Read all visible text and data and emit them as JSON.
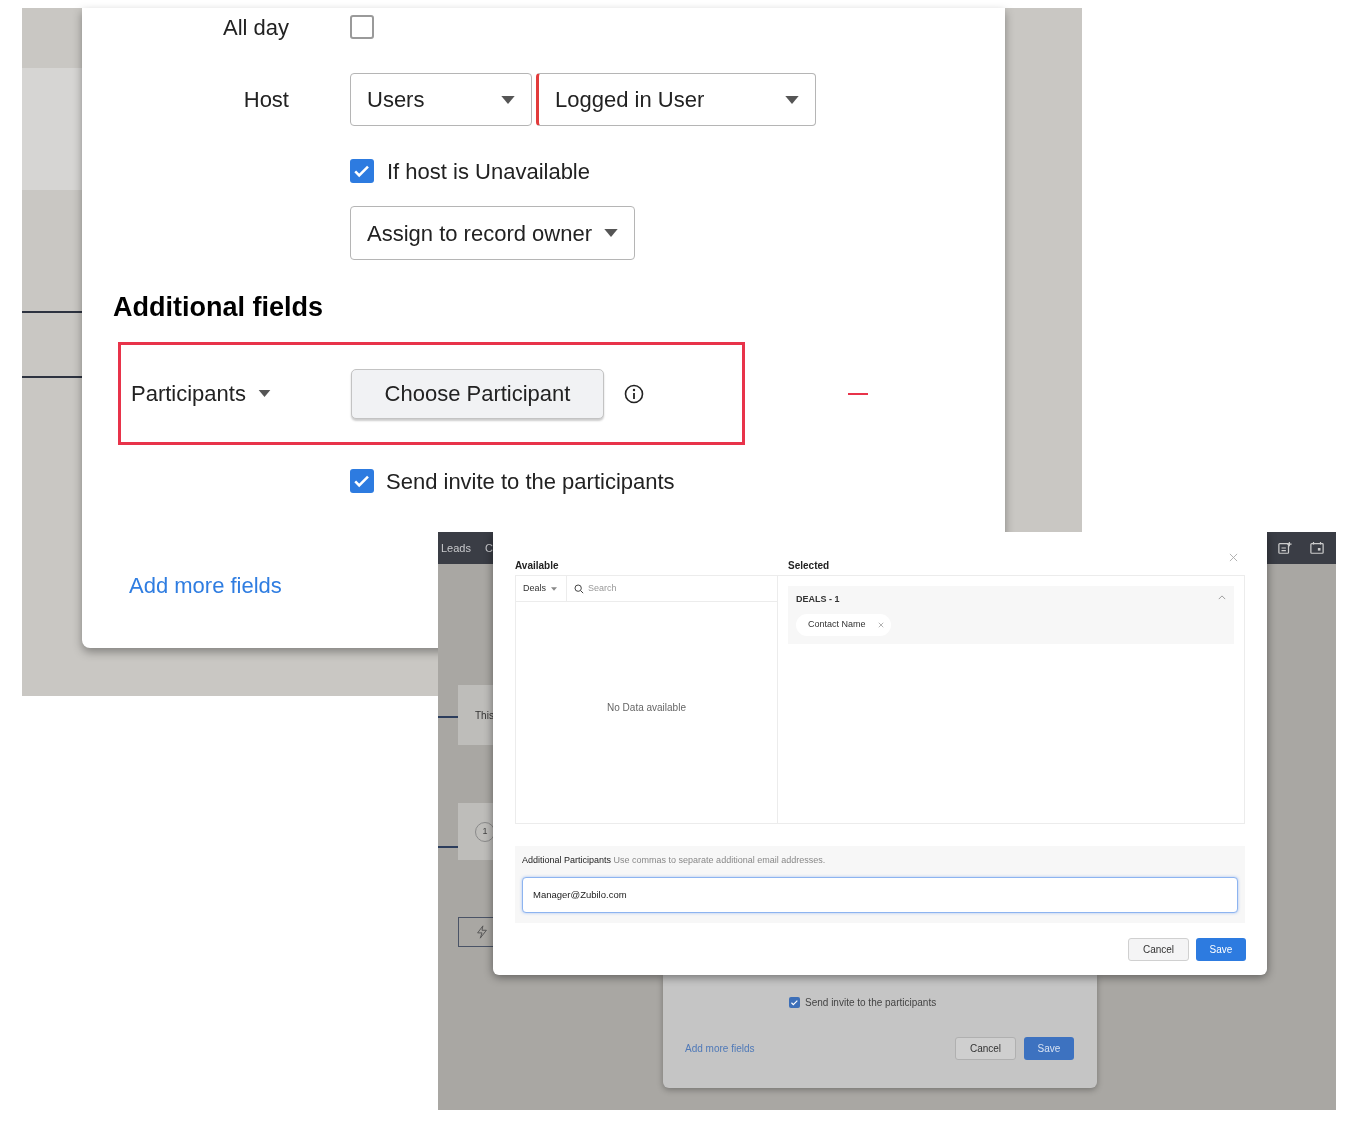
{
  "event_form": {
    "all_day": {
      "label": "All day",
      "checked": false
    },
    "host": {
      "label": "Host",
      "type": "Users",
      "user": "Logged in User"
    },
    "if_unavailable": {
      "label": "If host is Unavailable",
      "checked": true
    },
    "fallback": "Assign to record owner",
    "section_title": "Additional fields",
    "participants": {
      "label": "Participants",
      "button": "Choose Participant"
    },
    "send_invite": {
      "label": "Send invite to the participants",
      "checked": true
    },
    "add_more": "Add more fields"
  },
  "participant_dialog": {
    "nav": [
      "Leads",
      "C"
    ],
    "side": [
      "This",
      "1"
    ],
    "modal": {
      "available_title": "Available",
      "module": "Deals",
      "search_placeholder": "Search",
      "empty": "No Data available",
      "selected_title": "Selected",
      "groups": [
        {
          "title": "DEALS - 1",
          "expanded": true,
          "chips": [
            "Contact Name"
          ]
        }
      ],
      "additional_label": "Additional Participants",
      "additional_hint": "Use commas to separate additional email addresses.",
      "additional_value": "Manager@Zubilo.com",
      "buttons": [
        "Cancel",
        "Save"
      ]
    },
    "form_behind": {
      "send_invite": {
        "label": "Send invite to the participants",
        "checked": true
      },
      "add_more": "Add more fields",
      "buttons": [
        "Cancel",
        "Save"
      ]
    }
  }
}
